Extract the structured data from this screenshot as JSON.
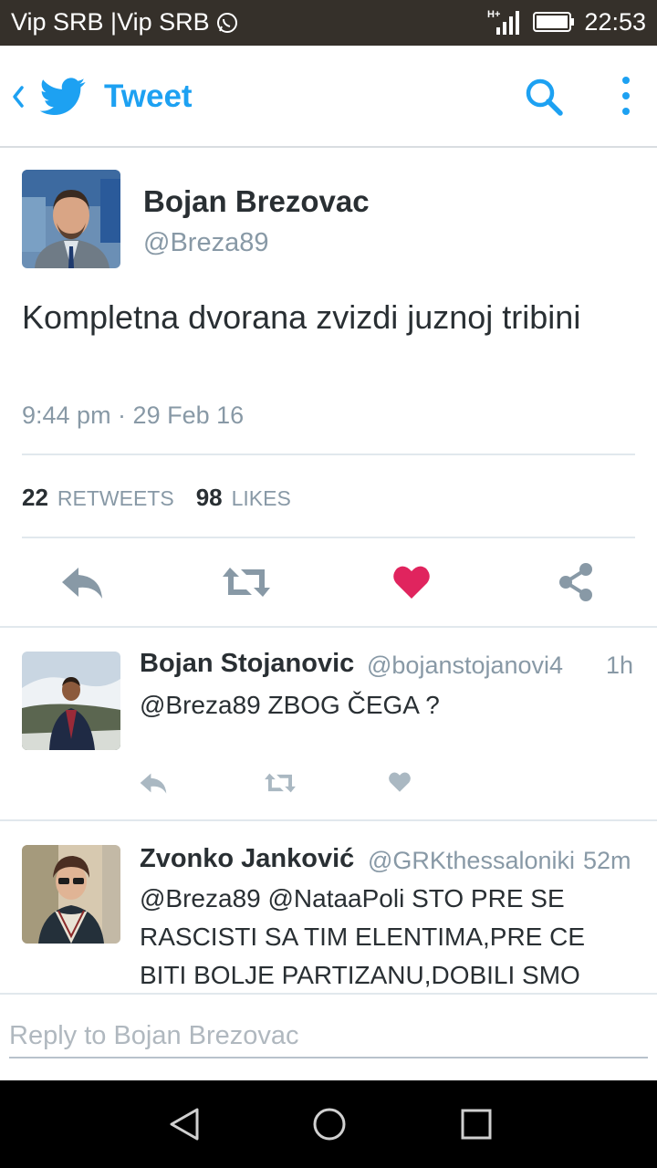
{
  "status_bar": {
    "carrier": "Vip SRB |Vip SRB",
    "network": "H+",
    "time": "22:53",
    "icons": [
      "whatsapp-icon",
      "signal-icon",
      "battery-icon"
    ]
  },
  "app_bar": {
    "title": "Tweet",
    "icons": [
      "back-icon",
      "twitter-bird-icon",
      "search-icon",
      "overflow-menu-icon"
    ]
  },
  "tweet": {
    "author_name": "Bojan Brezovac",
    "author_handle": "@Breza89",
    "text": "Kompletna dvorana zvizdi juznoj tribini",
    "timestamp": "9:44 pm · 29 Feb 16",
    "retweets_count": "22",
    "retweets_label": "RETWEETS",
    "likes_count": "98",
    "likes_label": "LIKES",
    "liked": true,
    "actions": [
      "reply-icon",
      "retweet-icon",
      "like-icon",
      "share-icon"
    ]
  },
  "replies": [
    {
      "name": "Bojan Stojanovic",
      "handle": "@bojanstojanovi4",
      "time": "1h",
      "text": "@Breza89 ZBOG ČEGA ?"
    },
    {
      "name": "Zvonko Janković",
      "handle": "@GRKthessaloniki",
      "time": "52m",
      "text": "@Breza89 @NataaPoli STO PRE SE RASCISTI SA TIM ELENTIMA,PRE CE BITI BOLJE PARTIZANU,DOBILI SMO"
    }
  ],
  "composer": {
    "placeholder": "Reply to Bojan Brezovac"
  },
  "colors": {
    "accent": "#1da1f2",
    "like": "#e0245e",
    "muted": "#8899a6",
    "text": "#292f33"
  }
}
